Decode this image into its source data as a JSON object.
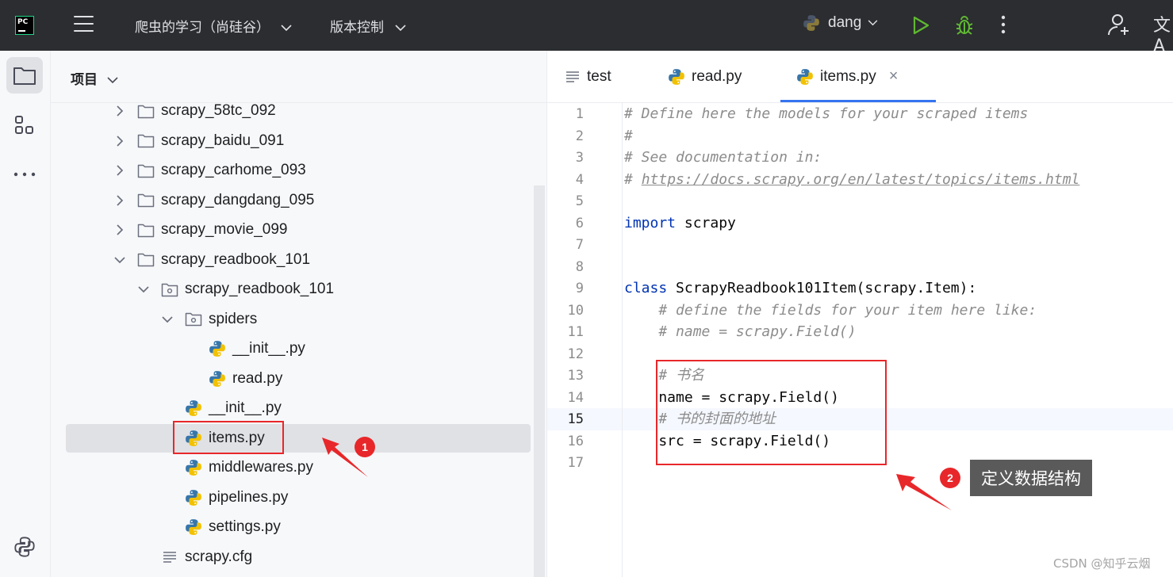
{
  "topbar": {
    "logo_text": "PC",
    "project_menu": "爬虫的学习（尚硅谷）",
    "vcs_menu": "版本控制",
    "run_config": "dang",
    "translate_glyph": "文A"
  },
  "panel": {
    "title": "项目",
    "tree": [
      {
        "label": "scrapy_58tc_092",
        "type": "folder",
        "expanded": false
      },
      {
        "label": "scrapy_baidu_091",
        "type": "folder",
        "expanded": false
      },
      {
        "label": "scrapy_carhome_093",
        "type": "folder",
        "expanded": false
      },
      {
        "label": "scrapy_dangdang_095",
        "type": "folder",
        "expanded": false
      },
      {
        "label": "scrapy_movie_099",
        "type": "folder",
        "expanded": false
      },
      {
        "label": "scrapy_readbook_101",
        "type": "folder",
        "expanded": true
      },
      {
        "label": "scrapy_readbook_101",
        "type": "package",
        "expanded": true
      },
      {
        "label": "spiders",
        "type": "package",
        "expanded": true
      },
      {
        "label": "__init__.py",
        "type": "python"
      },
      {
        "label": "read.py",
        "type": "python"
      },
      {
        "label": "__init__.py",
        "type": "python"
      },
      {
        "label": "items.py",
        "type": "python",
        "selected": true
      },
      {
        "label": "middlewares.py",
        "type": "python"
      },
      {
        "label": "pipelines.py",
        "type": "python"
      },
      {
        "label": "settings.py",
        "type": "python"
      },
      {
        "label": "scrapy.cfg",
        "type": "text"
      }
    ]
  },
  "editor": {
    "tabs": [
      {
        "label": "test",
        "type": "text"
      },
      {
        "label": "read.py",
        "type": "python"
      },
      {
        "label": "items.py",
        "type": "python",
        "active": true
      }
    ],
    "current_line": 15,
    "lines": [
      "# Define here the models for your scraped items",
      "#",
      "# See documentation in:",
      "# https://docs.scrapy.org/en/latest/topics/items.html",
      "",
      "import scrapy",
      "",
      "",
      "class ScrapyReadbook101Item(scrapy.Item):",
      "    # define the fields for your item here like:",
      "    # name = scrapy.Field()",
      "",
      "    # 书名",
      "    name = scrapy.Field()",
      "    # 书的封面的地址",
      "    src = scrapy.Field()",
      ""
    ]
  },
  "annotations": {
    "badge1": "1",
    "badge2": "2",
    "callout": "定义数据结构"
  },
  "watermark": "CSDN @知乎云烟",
  "colors": {
    "topbar_bg": "#2b2d30",
    "accent": "#3574f0",
    "annotation_red": "#e8272a",
    "run_green": "#5fb832"
  }
}
